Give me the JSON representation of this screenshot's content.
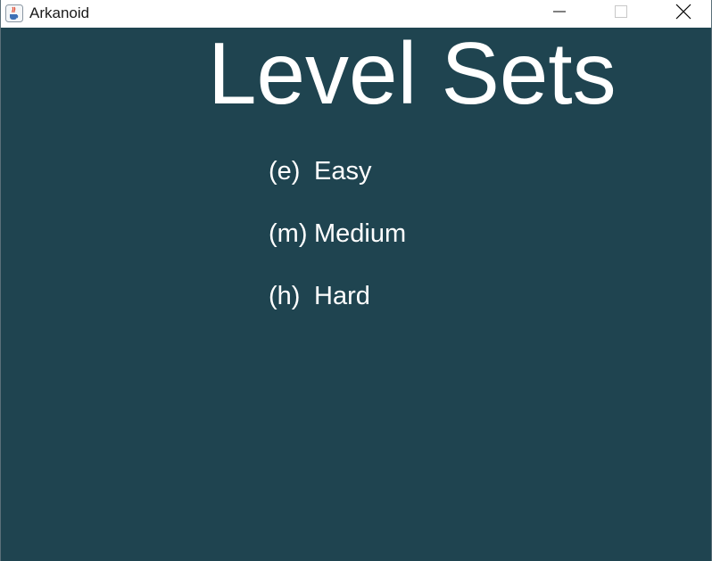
{
  "window": {
    "title": "Arkanoid",
    "app_icon": "java-cup-icon",
    "controls": [
      "minimize-icon",
      "maximize-icon",
      "close-icon"
    ]
  },
  "screen": {
    "heading": "Level Sets",
    "options": [
      {
        "key": "(e)",
        "label": "Easy"
      },
      {
        "key": "(m)",
        "label": "Medium"
      },
      {
        "key": "(h)",
        "label": "Hard"
      }
    ]
  },
  "colors": {
    "background": "#1f4450",
    "text": "#ffffff",
    "titlebar": "#ffffff"
  }
}
